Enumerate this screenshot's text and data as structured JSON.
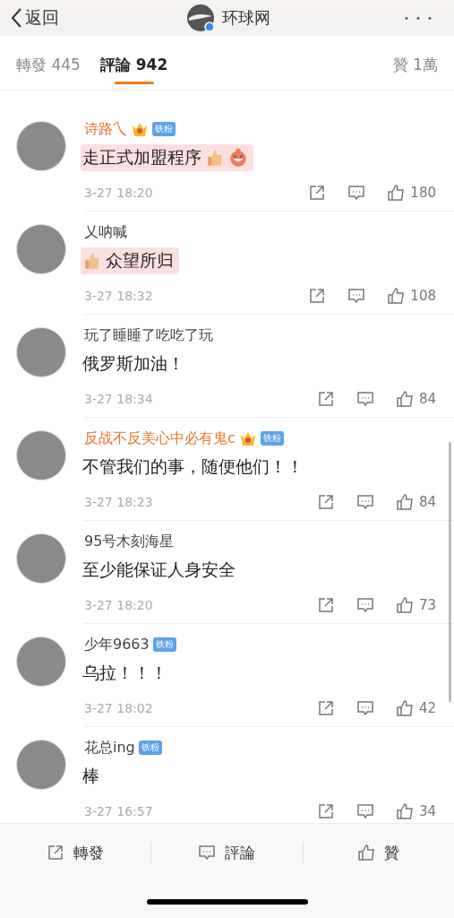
{
  "header": {
    "back": "返回",
    "title": "环球网",
    "more": "• • •"
  },
  "tabs": [
    {
      "label": "轉發 445",
      "selected": false
    },
    {
      "label": "評論 942",
      "selected": true
    },
    {
      "label": "贊 1萬",
      "selected": false
    }
  ],
  "comments": [
    {
      "name": "诗路乀",
      "vip": true,
      "badge": "铁粉",
      "text": "走正式加盟程序",
      "kind": "emoji-after",
      "highlighted": true,
      "time": "3-27 18:20",
      "likes": "180"
    },
    {
      "name": "乂呐喊",
      "vip": false,
      "text": "众望所归",
      "kind": "emoji-before",
      "highlighted": true,
      "time": "3-27 18:32",
      "likes": "108"
    },
    {
      "name": "玩了睡睡了吃吃了玩",
      "vip": false,
      "text": "俄罗斯加油！",
      "kind": "plain",
      "highlighted": false,
      "time": "3-27 18:34",
      "likes": "84"
    },
    {
      "name": "反战不反美心中必有鬼c",
      "vip": true,
      "badge": "铁粉",
      "text": "不管我们的事，随便他们！！",
      "kind": "plain",
      "highlighted": false,
      "time": "3-27 18:23",
      "likes": "84"
    },
    {
      "name": "95号木刻海星",
      "vip": false,
      "text": "至少能保证人身安全",
      "kind": "plain",
      "highlighted": false,
      "time": "3-27 18:20",
      "likes": "73"
    },
    {
      "name": "少年9663",
      "vip": false,
      "badge": "铁粉",
      "text": "乌拉！！！",
      "kind": "plain",
      "highlighted": false,
      "time": "3-27 18:02",
      "likes": "42"
    },
    {
      "name": "花总ing",
      "vip": false,
      "badge": "铁粉",
      "text": "棒",
      "kind": "plain",
      "highlighted": false,
      "time": "3-27 16:57",
      "likes": "34"
    }
  ],
  "bottom_bar": [
    {
      "label": "轉發",
      "kind": "share"
    },
    {
      "label": "評論",
      "kind": "comment"
    },
    {
      "label": "贊",
      "kind": "like"
    }
  ]
}
